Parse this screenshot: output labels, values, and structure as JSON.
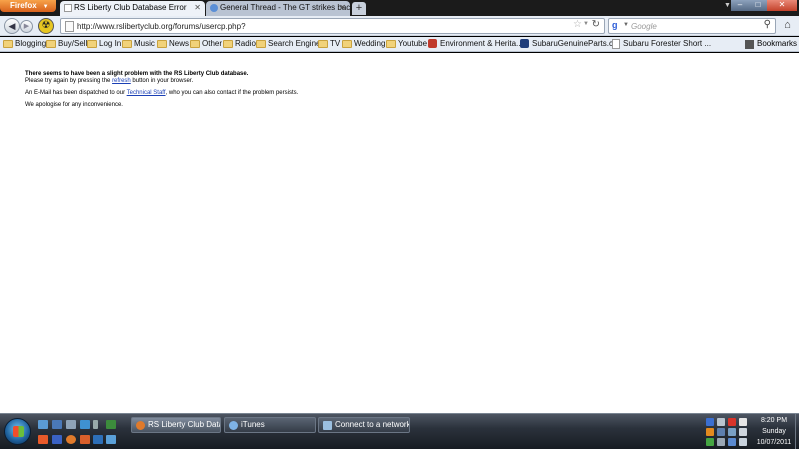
{
  "browser": {
    "menu_button": "Firefox",
    "tabs": [
      {
        "title": "RS Liberty Club Database Error",
        "active": true
      },
      {
        "title": "General Thread - The GT strikes back...",
        "active": false
      }
    ],
    "new_tab": "+",
    "url": "http://www.rslibertyclub.org/forums/usercp.php?",
    "search_placeholder": "Google"
  },
  "bookmarks": {
    "items": [
      {
        "label": "Blogging",
        "icon": "folder-icon"
      },
      {
        "label": "Buy/Sell",
        "icon": "folder-icon"
      },
      {
        "label": "Log In",
        "icon": "folder-icon"
      },
      {
        "label": "Music",
        "icon": "folder-icon"
      },
      {
        "label": "News",
        "icon": "folder-icon"
      },
      {
        "label": "Other",
        "icon": "folder-icon"
      },
      {
        "label": "Radio",
        "icon": "folder-icon"
      },
      {
        "label": "Search Engines",
        "icon": "folder-icon"
      },
      {
        "label": "TV",
        "icon": "folder-icon"
      },
      {
        "label": "Wedding",
        "icon": "folder-icon"
      },
      {
        "label": "Youtube",
        "icon": "folder-icon"
      },
      {
        "label": "Environment & Herita...",
        "icon": "site-icon"
      },
      {
        "label": "SubaruGenuineParts.c...",
        "icon": "site-icon"
      },
      {
        "label": "Subaru Forester Short ...",
        "icon": "page-icon"
      }
    ],
    "menu_label": "Bookmarks"
  },
  "page": {
    "heading": "There seems to have been a slight problem with the RS Liberty Club database.",
    "line1_pre": "Please try again by pressing the ",
    "line1_link": "refresh",
    "line1_post": " button in your browser.",
    "line2_pre": "An E-Mail has been dispatched to our ",
    "line2_link": "Technical Staff",
    "line2_post": ", who you can also contact if the problem persists.",
    "line3": "We apologise for any inconvenience."
  },
  "taskbar": {
    "tasks": [
      {
        "label": "RS Liberty Club Data...",
        "icon": "firefox-icon",
        "active": true
      },
      {
        "label": "iTunes",
        "icon": "itunes-icon",
        "active": false
      },
      {
        "label": "Connect to a network",
        "icon": "network-icon",
        "active": false
      }
    ],
    "clock": {
      "time": "8:20 PM",
      "day": "Sunday",
      "date": "10/07/2011"
    }
  },
  "colors": {
    "link": "#1a3fb5",
    "firefox_orange": "#e07a2b",
    "folder": "#f1d27a"
  }
}
